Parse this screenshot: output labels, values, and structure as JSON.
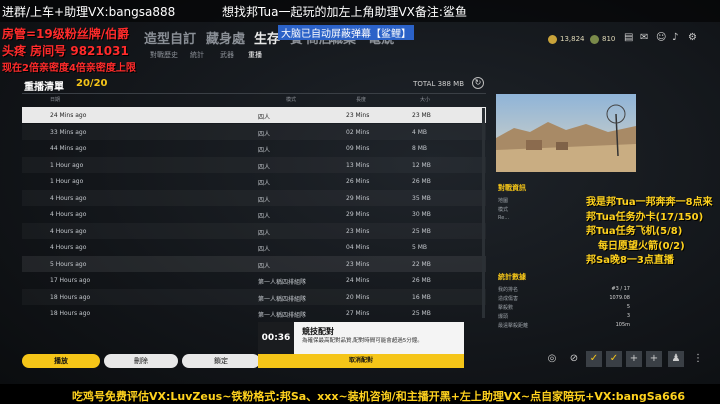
{
  "nav": {
    "tabs": [
      "造型自訂",
      "藏身處",
      "生存",
      "賽",
      "商店",
      "職業",
      "電競"
    ],
    "subtabs": [
      "對戰歷史",
      "統計",
      "武器",
      "重播"
    ]
  },
  "currency": {
    "bp": "13,824",
    "g": "810"
  },
  "replay": {
    "title": "重播清單",
    "count": "20/20",
    "total": "TOTAL 388 MB",
    "columns": {
      "date": "日期",
      "mode": "模式",
      "length": "長度",
      "size": "大小"
    },
    "rows": [
      {
        "date": "24 Mins ago",
        "mode": "四人",
        "length": "23 Mins",
        "size": "23 MB"
      },
      {
        "date": "33 Mins ago",
        "mode": "四人",
        "length": "02 Mins",
        "size": "4 MB"
      },
      {
        "date": "44 Mins ago",
        "mode": "四人",
        "length": "09 Mins",
        "size": "8 MB"
      },
      {
        "date": "1 Hour ago",
        "mode": "四人",
        "length": "13 Mins",
        "size": "12 MB"
      },
      {
        "date": "1 Hour ago",
        "mode": "四人",
        "length": "26 Mins",
        "size": "26 MB"
      },
      {
        "date": "4 Hours ago",
        "mode": "四人",
        "length": "29 Mins",
        "size": "35 MB"
      },
      {
        "date": "4 Hours ago",
        "mode": "四人",
        "length": "29 Mins",
        "size": "30 MB"
      },
      {
        "date": "4 Hours ago",
        "mode": "四人",
        "length": "23 Mins",
        "size": "25 MB"
      },
      {
        "date": "4 Hours ago",
        "mode": "四人",
        "length": "04 Mins",
        "size": "5 MB"
      },
      {
        "date": "5 Hours ago",
        "mode": "四人",
        "length": "23 Mins",
        "size": "22 MB"
      },
      {
        "date": "17 Hours ago",
        "mode": "第一人稱四排組隊",
        "length": "24 Mins",
        "size": "26 MB"
      },
      {
        "date": "18 Hours ago",
        "mode": "第一人稱四排組隊",
        "length": "20 Mins",
        "size": "16 MB"
      },
      {
        "date": "18 Hours ago",
        "mode": "第一人稱四排組隊",
        "length": "27 Mins",
        "size": "25 MB"
      }
    ]
  },
  "buttons": {
    "play": "播放",
    "delete": "刪除",
    "lock": "鎖定"
  },
  "matchmaking": {
    "timer": "00:36",
    "title": "競技配對",
    "desc": "為確保最高配對品質,配對時間可能會超過5分鐘。",
    "cancel": "取消配對"
  },
  "info": {
    "match_title": "對戰資訊",
    "match_rows": [
      {
        "label": "地圖",
        "value": ""
      },
      {
        "label": "模式",
        "value": ""
      },
      {
        "label": "Re...",
        "value": ""
      }
    ],
    "stats_title": "統計數據",
    "stats_rows": [
      {
        "label": "我的排名",
        "value": "#3 / 17"
      },
      {
        "label": "造成傷害",
        "value": "1079.08"
      },
      {
        "label": "擊殺數",
        "value": "5"
      },
      {
        "label": "爆頭",
        "value": "3"
      },
      {
        "label": "最遠擊殺距離",
        "value": "105m"
      }
    ]
  },
  "overlay": {
    "top_left": "进群/上车+助理VX:bangsa888",
    "top_right": "想找邦Tua一起玩的加左上角助理VX备注:鲨鱼",
    "line2": "房管=19级粉丝牌/伯爵",
    "line3": "头疼 房间号 9821031",
    "line4": "现在2倍亲密度4倍亲密度上限",
    "banner": "大脑已自动屏蔽弹幕【鲨鲤】",
    "right": [
      "我是邦Tua一邦奔奔一8点来",
      "邦Tua任务办卡(17/150)",
      "邦Tua任务飞机(5/8)",
      "每日愿望火箭(0/2)",
      "邦Sa晚8一3点直播"
    ],
    "bottom": "吃鸡号免费评估VX:LuvZeus~铁粉格式:邦Sa、xxx~装机咨询/和主播开黑+左上助理VX~点自家陪玩+VX:bangSa666"
  }
}
